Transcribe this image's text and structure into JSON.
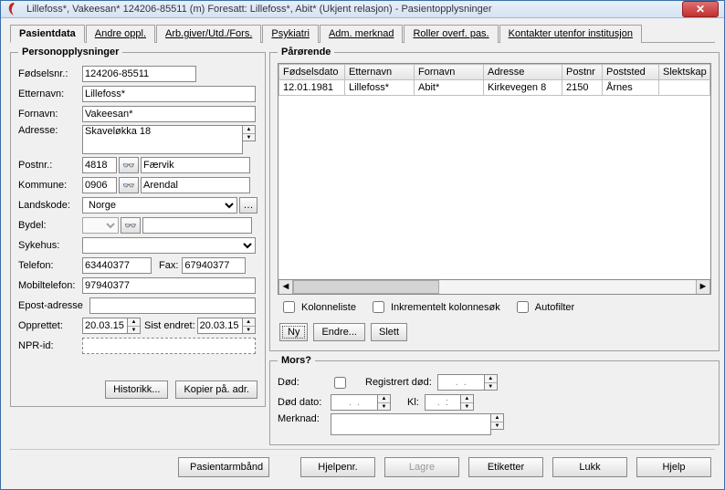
{
  "window": {
    "title": "Lillefoss*, Vakeesan*  124206-85511 (m)  Foresatt: Lillefoss*, Abit* (Ukjent relasjon)  - Pasientopplysninger"
  },
  "tabs": [
    "Pasientdata",
    "Andre oppl.",
    "Arb.giver/Utd./Fors.",
    "Psykiatri",
    "Adm. merknad",
    "Roller overf. pas.",
    "Kontakter utenfor institusjon"
  ],
  "person": {
    "legend": "Personopplysninger",
    "labels": {
      "fodselsnr": "Fødselsnr.:",
      "etternavn": "Etternavn:",
      "fornavn": "Fornavn:",
      "adresse": "Adresse:",
      "postnr": "Postnr.:",
      "kommune": "Kommune:",
      "landskode": "Landskode:",
      "bydel": "Bydel:",
      "sykehus": "Sykehus:",
      "telefon": "Telefon:",
      "fax": "Fax:",
      "mobil": "Mobiltelefon:",
      "epost": "Epost-adresse",
      "opprettet": "Opprettet:",
      "sist_endret": "Sist endret:",
      "npr": "NPR-id:"
    },
    "values": {
      "fodselsnr": "124206-85511",
      "etternavn": "Lillefoss*",
      "fornavn": "Vakeesan*",
      "adresse": "Skaveløkka 18",
      "postnr": "4818",
      "poststed": "Færvik",
      "kommune_nr": "0906",
      "kommune_navn": "Arendal",
      "landskode": "Norge",
      "telefon": "63440377",
      "fax": "67940377",
      "mobil": "97940377",
      "epost": "",
      "opprettet": "20.03.15",
      "sist_endret": "20.03.15",
      "npr": ""
    },
    "buttons": {
      "historikk": "Historikk...",
      "kopier": "Kopier på. adr."
    }
  },
  "parorende": {
    "legend": "Pårørende",
    "columns": [
      "Fødselsdato",
      "Etternavn",
      "Fornavn",
      "Adresse",
      "Postnr",
      "Poststed",
      "Slektskap"
    ],
    "rows": [
      {
        "fdato": "12.01.1981",
        "etternavn": "Lillefoss*",
        "fornavn": "Abit*",
        "adresse": "Kirkevegen 8",
        "postnr": "2150",
        "poststed": "Årnes",
        "slekt": ""
      }
    ],
    "checks": {
      "kolonneliste": "Kolonneliste",
      "inkrementelt": "Inkrementelt kolonnesøk",
      "autofilter": "Autofilter"
    },
    "buttons": {
      "ny": "Ny",
      "endre": "Endre...",
      "slett": "Slett"
    }
  },
  "mors": {
    "legend": "Mors?",
    "labels": {
      "dod": "Død:",
      "registrert": "Registrert død:",
      "dod_dato": "Død dato:",
      "kl": "Kl:",
      "merknad": "Merknad:"
    },
    "dateplaceholder": ".  .",
    "timeplaceholder": ".  :"
  },
  "bottom": {
    "pasientarmband": "Pasientarmbånd",
    "hjelpenr": "Hjelpenr.",
    "lagre": "Lagre",
    "etiketter": "Etiketter",
    "lukk": "Lukk",
    "hjelp": "Hjelp"
  }
}
